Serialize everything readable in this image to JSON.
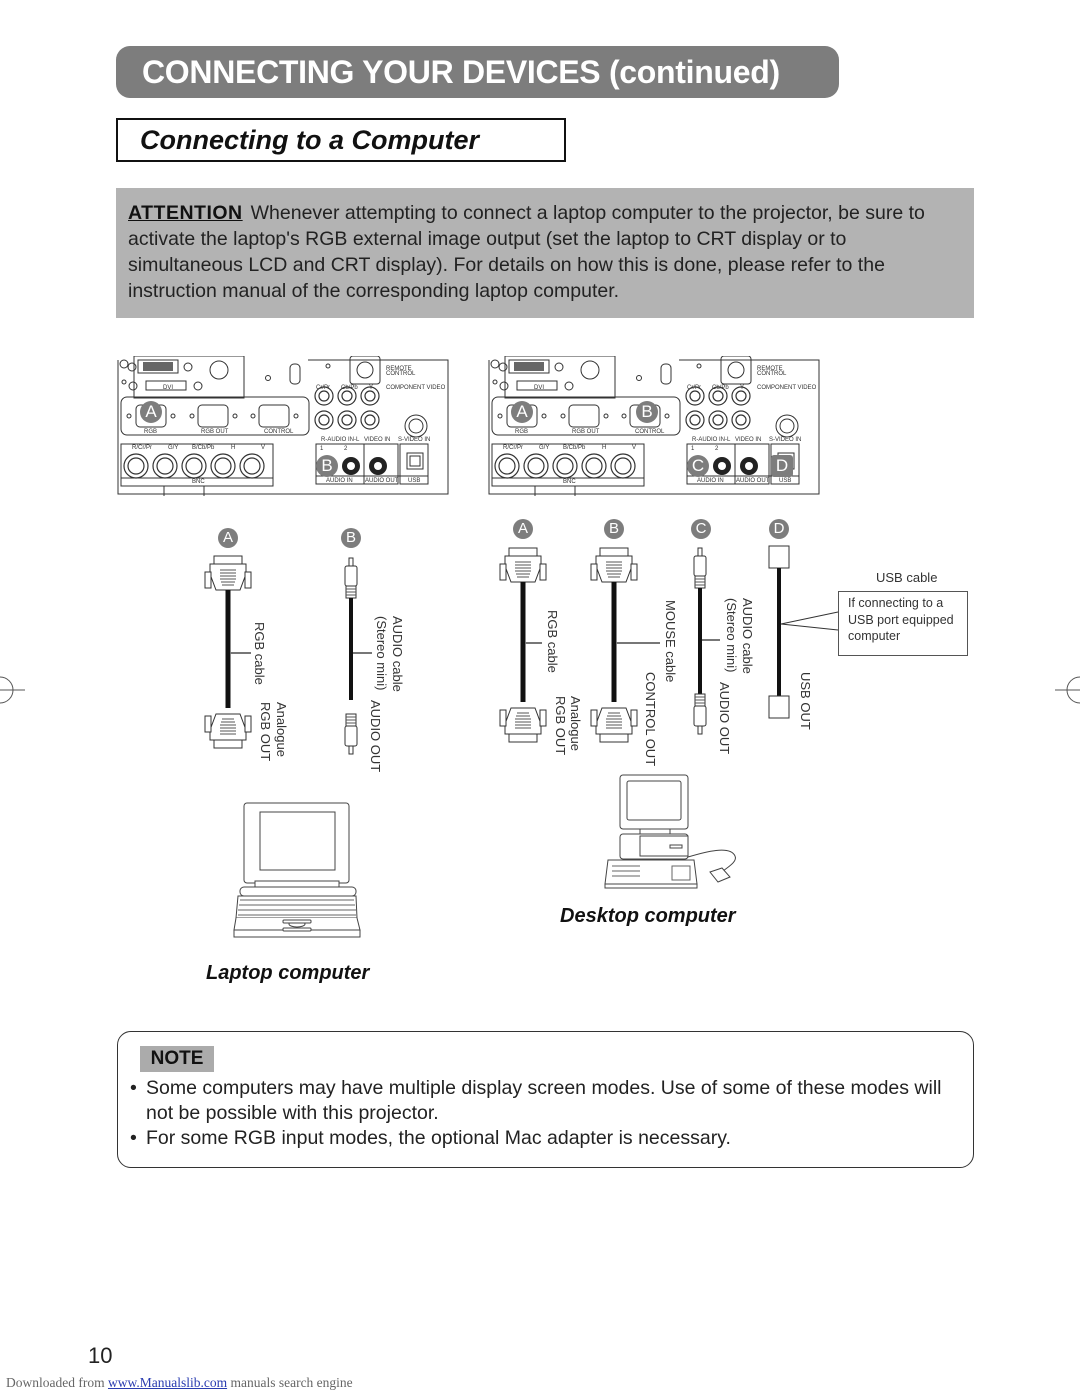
{
  "header": {
    "banner_title": "CONNECTING YOUR DEVICES (continued)",
    "section_title": "Connecting to a Computer"
  },
  "attention": {
    "label": "ATTENTION",
    "text": "Whenever attempting to connect a laptop computer to the projector, be sure to activate the laptop's RGB external image output (set the laptop to CRT display or to simultaneous LCD and CRT display). For details on how this is done, please refer to the instruction manual of the corresponding laptop computer."
  },
  "panel_labels": {
    "dvi": "DVI",
    "rgb": "RGB",
    "rgb_out": "RGB OUT",
    "control": "CONTROL",
    "remote_control_1": "REMOTE",
    "remote_control_2": "CONTROL",
    "cr_pr": "Cr/Pr",
    "cb_pb": "Cb/Pb",
    "y": "Y",
    "component_video": "COMPONENT VIDEO",
    "audio_in_rl": "R-AUDIO IN-L",
    "video_in": "VIDEO IN",
    "s_video_in": "S-VIDEO IN",
    "bnc_r": "R/Cr/Pr",
    "bnc_g": "G/Y",
    "bnc_b": "B/Cb/Pb",
    "bnc_h": "H",
    "bnc_v": "V",
    "bnc": "BNC",
    "audio_in": "AUDIO IN",
    "audio_out": "AUDIO OUT",
    "usb": "USB",
    "in1": "1",
    "in2": "2"
  },
  "laptop_setup": {
    "panel_badges": [
      "A",
      "B"
    ],
    "cable_badges": [
      "A",
      "B"
    ],
    "cables": [
      {
        "name": "RGB cable",
        "end_label_1": "Analogue",
        "end_label_2": "RGB OUT"
      },
      {
        "name_1": "AUDIO cable",
        "name_2": "(Stereo mini)",
        "end_label": "AUDIO OUT"
      }
    ],
    "caption": "Laptop computer"
  },
  "desktop_setup": {
    "panel_badges": [
      "A",
      "B",
      "C",
      "D"
    ],
    "cable_badges": [
      "A",
      "B",
      "C",
      "D"
    ],
    "cables": [
      {
        "name": "RGB cable",
        "end_label_1": "Analogue",
        "end_label_2": "RGB OUT"
      },
      {
        "name": "MOUSE cable",
        "end_label": "CONTROL OUT"
      },
      {
        "name_1": "AUDIO cable",
        "name_2": "(Stereo mini)",
        "end_label": "AUDIO OUT"
      },
      {
        "name": "USB cable",
        "end_label": "USB OUT",
        "callout": "If connecting to a USB port equipped computer"
      }
    ],
    "caption": "Desktop computer"
  },
  "note": {
    "label": "NOTE",
    "items": [
      "Some computers may have multiple display screen modes. Use of some of these modes will not be possible with this projector.",
      "For some RGB input modes, the optional Mac adapter is necessary."
    ]
  },
  "footer": {
    "page_number": "10",
    "prefix": "Downloaded from",
    "link": "www.Manualslib.com",
    "suffix": "manuals search engine"
  },
  "colors": {
    "banner_bg": "#7d7d7d",
    "attention_bg": "#b3b3b3",
    "note_label_bg": "#ababab",
    "badge_bg": "#7d7d7d",
    "link": "#2a3cb0"
  }
}
